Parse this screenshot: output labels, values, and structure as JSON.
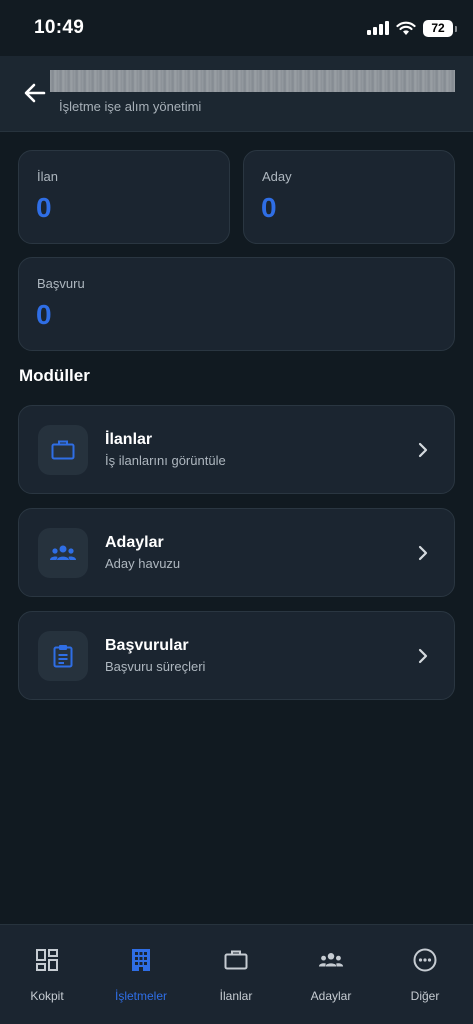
{
  "status": {
    "time": "10:49",
    "battery": "72"
  },
  "header": {
    "subtitle": "İşletme işe alım yönetimi"
  },
  "stats": [
    {
      "label": "İlan",
      "value": "0"
    },
    {
      "label": "Aday",
      "value": "0"
    },
    {
      "label": "Başvuru",
      "value": "0"
    }
  ],
  "modules_title": "Modüller",
  "modules": [
    {
      "title": "İlanlar",
      "subtitle": "İş ilanlarını görüntüle",
      "icon": "briefcase-icon"
    },
    {
      "title": "Adaylar",
      "subtitle": "Aday havuzu",
      "icon": "people-icon"
    },
    {
      "title": "Başvurular",
      "subtitle": "Başvuru süreçleri",
      "icon": "clipboard-icon"
    }
  ],
  "tabs": [
    {
      "label": "Kokpit",
      "icon": "dashboard-icon",
      "active": false
    },
    {
      "label": "İşletmeler",
      "icon": "building-icon",
      "active": true
    },
    {
      "label": "İlanlar",
      "icon": "briefcase-icon",
      "active": false
    },
    {
      "label": "Adaylar",
      "icon": "people-icon",
      "active": false
    },
    {
      "label": "Diğer",
      "icon": "more-icon",
      "active": false
    }
  ],
  "colors": {
    "accent": "#2f6ee5",
    "background": "#111a21",
    "card": "#1b2530"
  }
}
